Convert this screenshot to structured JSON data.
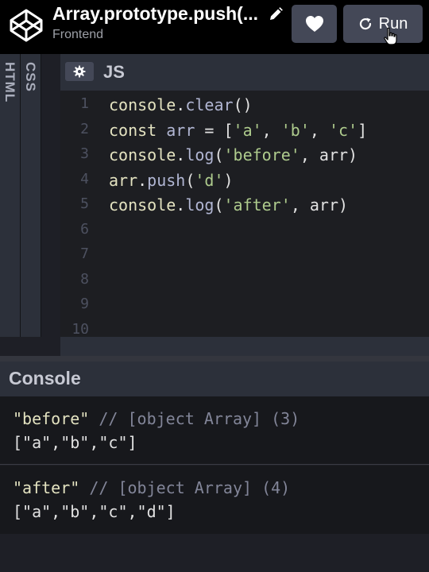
{
  "header": {
    "title": "Array.prototype.push(...",
    "subtitle": "Frontend",
    "run_label": "Run"
  },
  "editor": {
    "tabs": [
      "HTML",
      "CSS"
    ],
    "active_tab": "JS",
    "lines": [
      {
        "num": "1",
        "tokens": [
          {
            "t": "console",
            "c": "obj"
          },
          {
            "t": ".",
            "c": "pun"
          },
          {
            "t": "clear",
            "c": "fn"
          },
          {
            "t": "()",
            "c": "pun"
          }
        ]
      },
      {
        "num": "2",
        "tokens": [
          {
            "t": "const ",
            "c": "kw"
          },
          {
            "t": "arr",
            "c": "fn"
          },
          {
            "t": " = [",
            "c": "pun"
          },
          {
            "t": "'a'",
            "c": "str"
          },
          {
            "t": ", ",
            "c": "pun"
          },
          {
            "t": "'b'",
            "c": "str"
          },
          {
            "t": ", ",
            "c": "pun"
          },
          {
            "t": "'c'",
            "c": "str"
          },
          {
            "t": "]",
            "c": "pun"
          }
        ]
      },
      {
        "num": "3",
        "tokens": [
          {
            "t": "console",
            "c": "obj"
          },
          {
            "t": ".",
            "c": "pun"
          },
          {
            "t": "log",
            "c": "fn"
          },
          {
            "t": "(",
            "c": "pun"
          },
          {
            "t": "'before'",
            "c": "str"
          },
          {
            "t": ", arr)",
            "c": "pun"
          }
        ]
      },
      {
        "num": "4",
        "tokens": [
          {
            "t": "arr",
            "c": "obj"
          },
          {
            "t": ".",
            "c": "pun"
          },
          {
            "t": "push",
            "c": "fn"
          },
          {
            "t": "(",
            "c": "pun"
          },
          {
            "t": "'d'",
            "c": "str"
          },
          {
            "t": ")",
            "c": "pun"
          }
        ]
      },
      {
        "num": "5",
        "tokens": [
          {
            "t": "console",
            "c": "obj"
          },
          {
            "t": ".",
            "c": "pun"
          },
          {
            "t": "log",
            "c": "fn"
          },
          {
            "t": "(",
            "c": "pun"
          },
          {
            "t": "'after'",
            "c": "str"
          },
          {
            "t": ", arr)",
            "c": "pun"
          }
        ]
      },
      {
        "num": "6",
        "tokens": []
      },
      {
        "num": "7",
        "tokens": []
      },
      {
        "num": "8",
        "tokens": []
      },
      {
        "num": "9",
        "tokens": []
      },
      {
        "num": "10",
        "tokens": []
      }
    ]
  },
  "console": {
    "title": "Console",
    "entries": [
      {
        "label": "\"before\"",
        "comment": " // [object Array] (3)",
        "value": "[\"a\",\"b\",\"c\"]"
      },
      {
        "label": "\"after\"",
        "comment": " // [object Array] (4)",
        "value": "[\"a\",\"b\",\"c\",\"d\"]"
      }
    ]
  },
  "icons": {
    "logo": "codepen-logo-icon",
    "edit": "pencil-icon",
    "heart": "heart-icon",
    "run": "refresh-icon",
    "settings": "gear-icon",
    "cursor": "hand-pointer-icon"
  },
  "colors": {
    "background": "#131417",
    "button": "#444857",
    "string": "#aecb8d",
    "object": "#e4e3c1",
    "function": "#b1b6d3"
  }
}
